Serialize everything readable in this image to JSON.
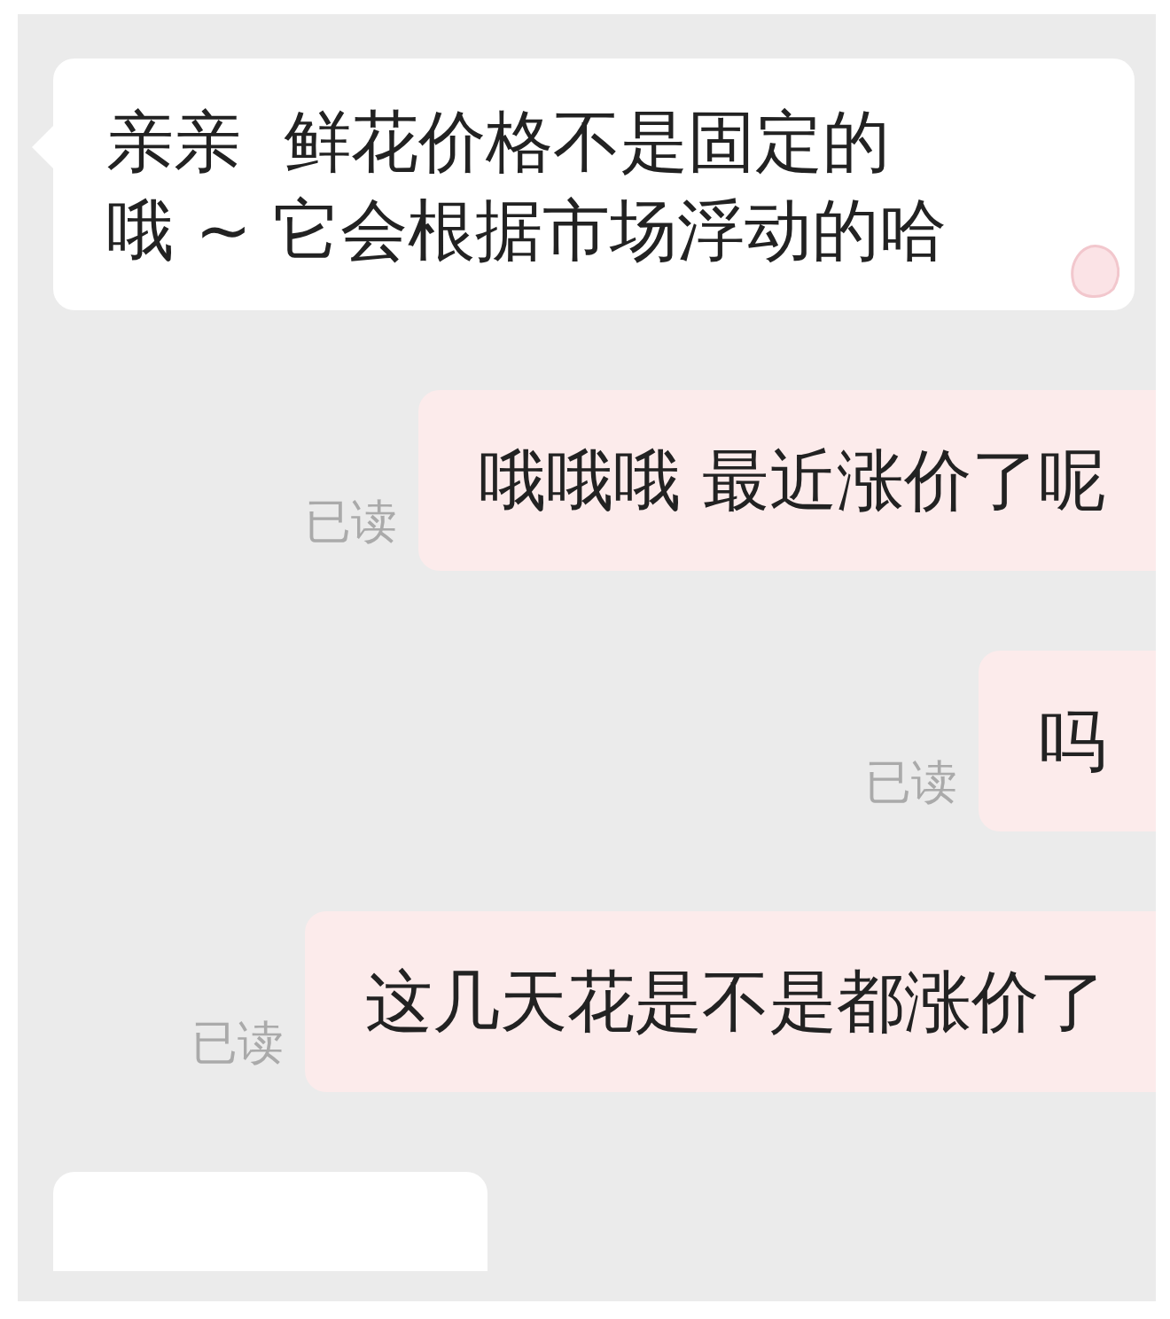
{
  "messages": [
    {
      "kind": "incoming",
      "lines": [
        "亲亲  鲜花价格不是固定的",
        "哦 ~ 它会根据市场浮动的哈"
      ],
      "sticker": true
    },
    {
      "kind": "outgoing",
      "lines": [
        "哦哦哦 最近涨价了呢"
      ],
      "receipt": "已读"
    },
    {
      "kind": "outgoing",
      "lines": [
        "吗"
      ],
      "receipt": "已读"
    },
    {
      "kind": "outgoing",
      "lines": [
        "这几天花是不是都涨价了"
      ],
      "receipt": "已读"
    },
    {
      "kind": "incoming"
    }
  ]
}
